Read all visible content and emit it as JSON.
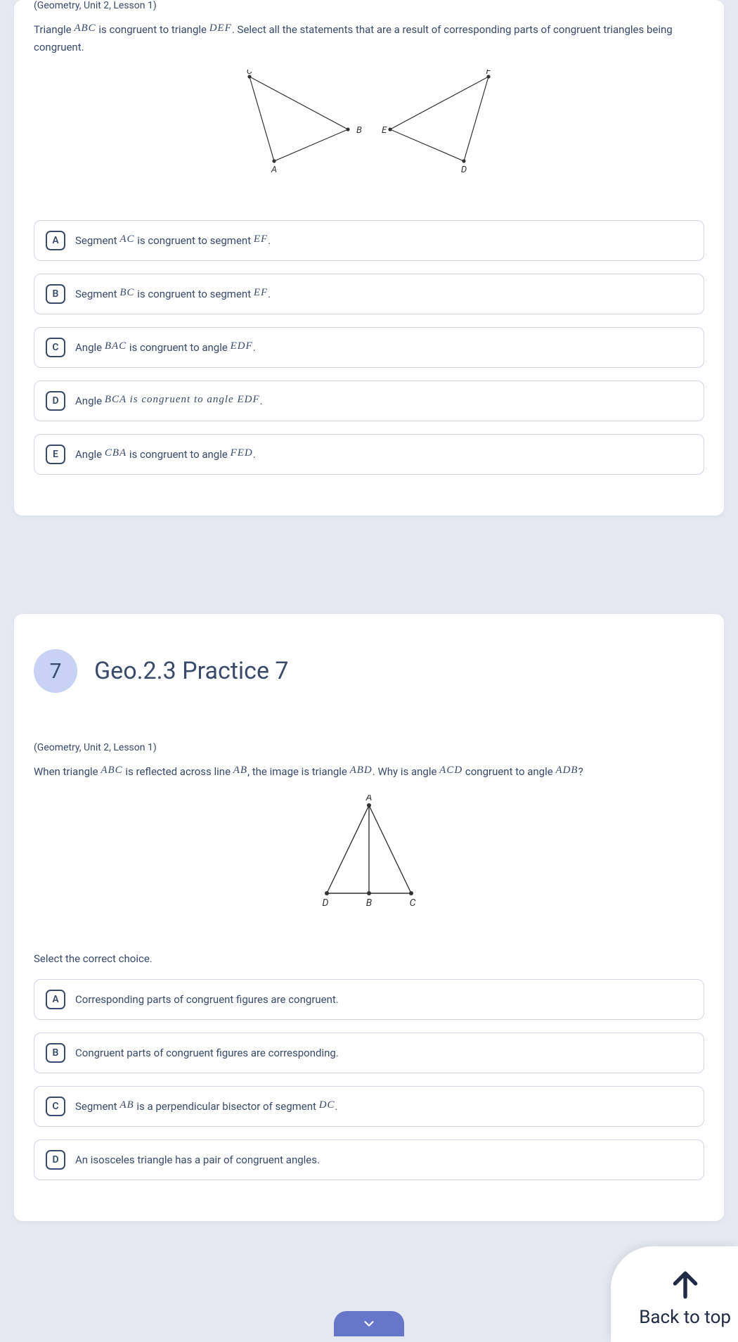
{
  "q6": {
    "lesson_ref": "(Geometry, Unit 2, Lesson 1)",
    "prompt_pre": "Triangle ",
    "prompt_v1": "ABC",
    "prompt_mid1": " is congruent to triangle ",
    "prompt_v2": "DEF",
    "prompt_post": ". Select all the statements that are a result of corresponding parts of congruent triangles being congruent.",
    "choices": {
      "A": {
        "letter": "A",
        "pre": "Segment ",
        "v1": "AC",
        "mid": " is congruent to segment ",
        "v2": "EF",
        "post": "."
      },
      "B": {
        "letter": "B",
        "pre": "Segment ",
        "v1": "BC",
        "mid": " is congruent to segment ",
        "v2": "EF",
        "post": "."
      },
      "C": {
        "letter": "C",
        "pre": "Angle ",
        "v1": "BAC",
        "mid": " is congruent to angle ",
        "v2": "EDF",
        "post": "."
      },
      "D": {
        "letter": "D",
        "pre": "Angle ",
        "v1": "BCA",
        "mid": " is congruent to angle ",
        "v2": "EDF",
        "post": "."
      },
      "E": {
        "letter": "E",
        "pre": "Angle ",
        "v1": "CBA",
        "mid": " is congruent to angle ",
        "v2": "FED",
        "post": "."
      }
    },
    "labels": {
      "A": "A",
      "B": "B",
      "C": "C",
      "D": "D",
      "E": "E",
      "F": "F"
    }
  },
  "q7": {
    "number": "7",
    "title": "Geo.2.3 Practice 7",
    "lesson_ref": "(Geometry, Unit 2, Lesson 1)",
    "prompt_pre": "When triangle ",
    "prompt_v1": "ABC",
    "prompt_mid1": " is reflected across line ",
    "prompt_v2": "AB",
    "prompt_mid2": ", the image is triangle ",
    "prompt_v3": "ABD",
    "prompt_mid3": ". Why is angle ",
    "prompt_v4": "ACD",
    "prompt_mid4": " congruent to angle ",
    "prompt_v5": "ADB",
    "prompt_post": "?",
    "labels": {
      "A": "A",
      "B": "B",
      "C": "C",
      "D": "D"
    },
    "instr": "Select the correct choice.",
    "choices": {
      "A": {
        "letter": "A",
        "text": "Corresponding parts of congruent figures are congruent."
      },
      "B": {
        "letter": "B",
        "text": "Congruent parts of congruent figures are corresponding."
      },
      "C": {
        "letter": "C",
        "pre": "Segment ",
        "v1": "AB",
        "mid": " is a perpendicular bisector of segment ",
        "v2": "DC",
        "post": "."
      },
      "D": {
        "letter": "D",
        "text": "An isosceles triangle has a pair of congruent angles."
      }
    }
  },
  "back_to_top": "Back to top"
}
